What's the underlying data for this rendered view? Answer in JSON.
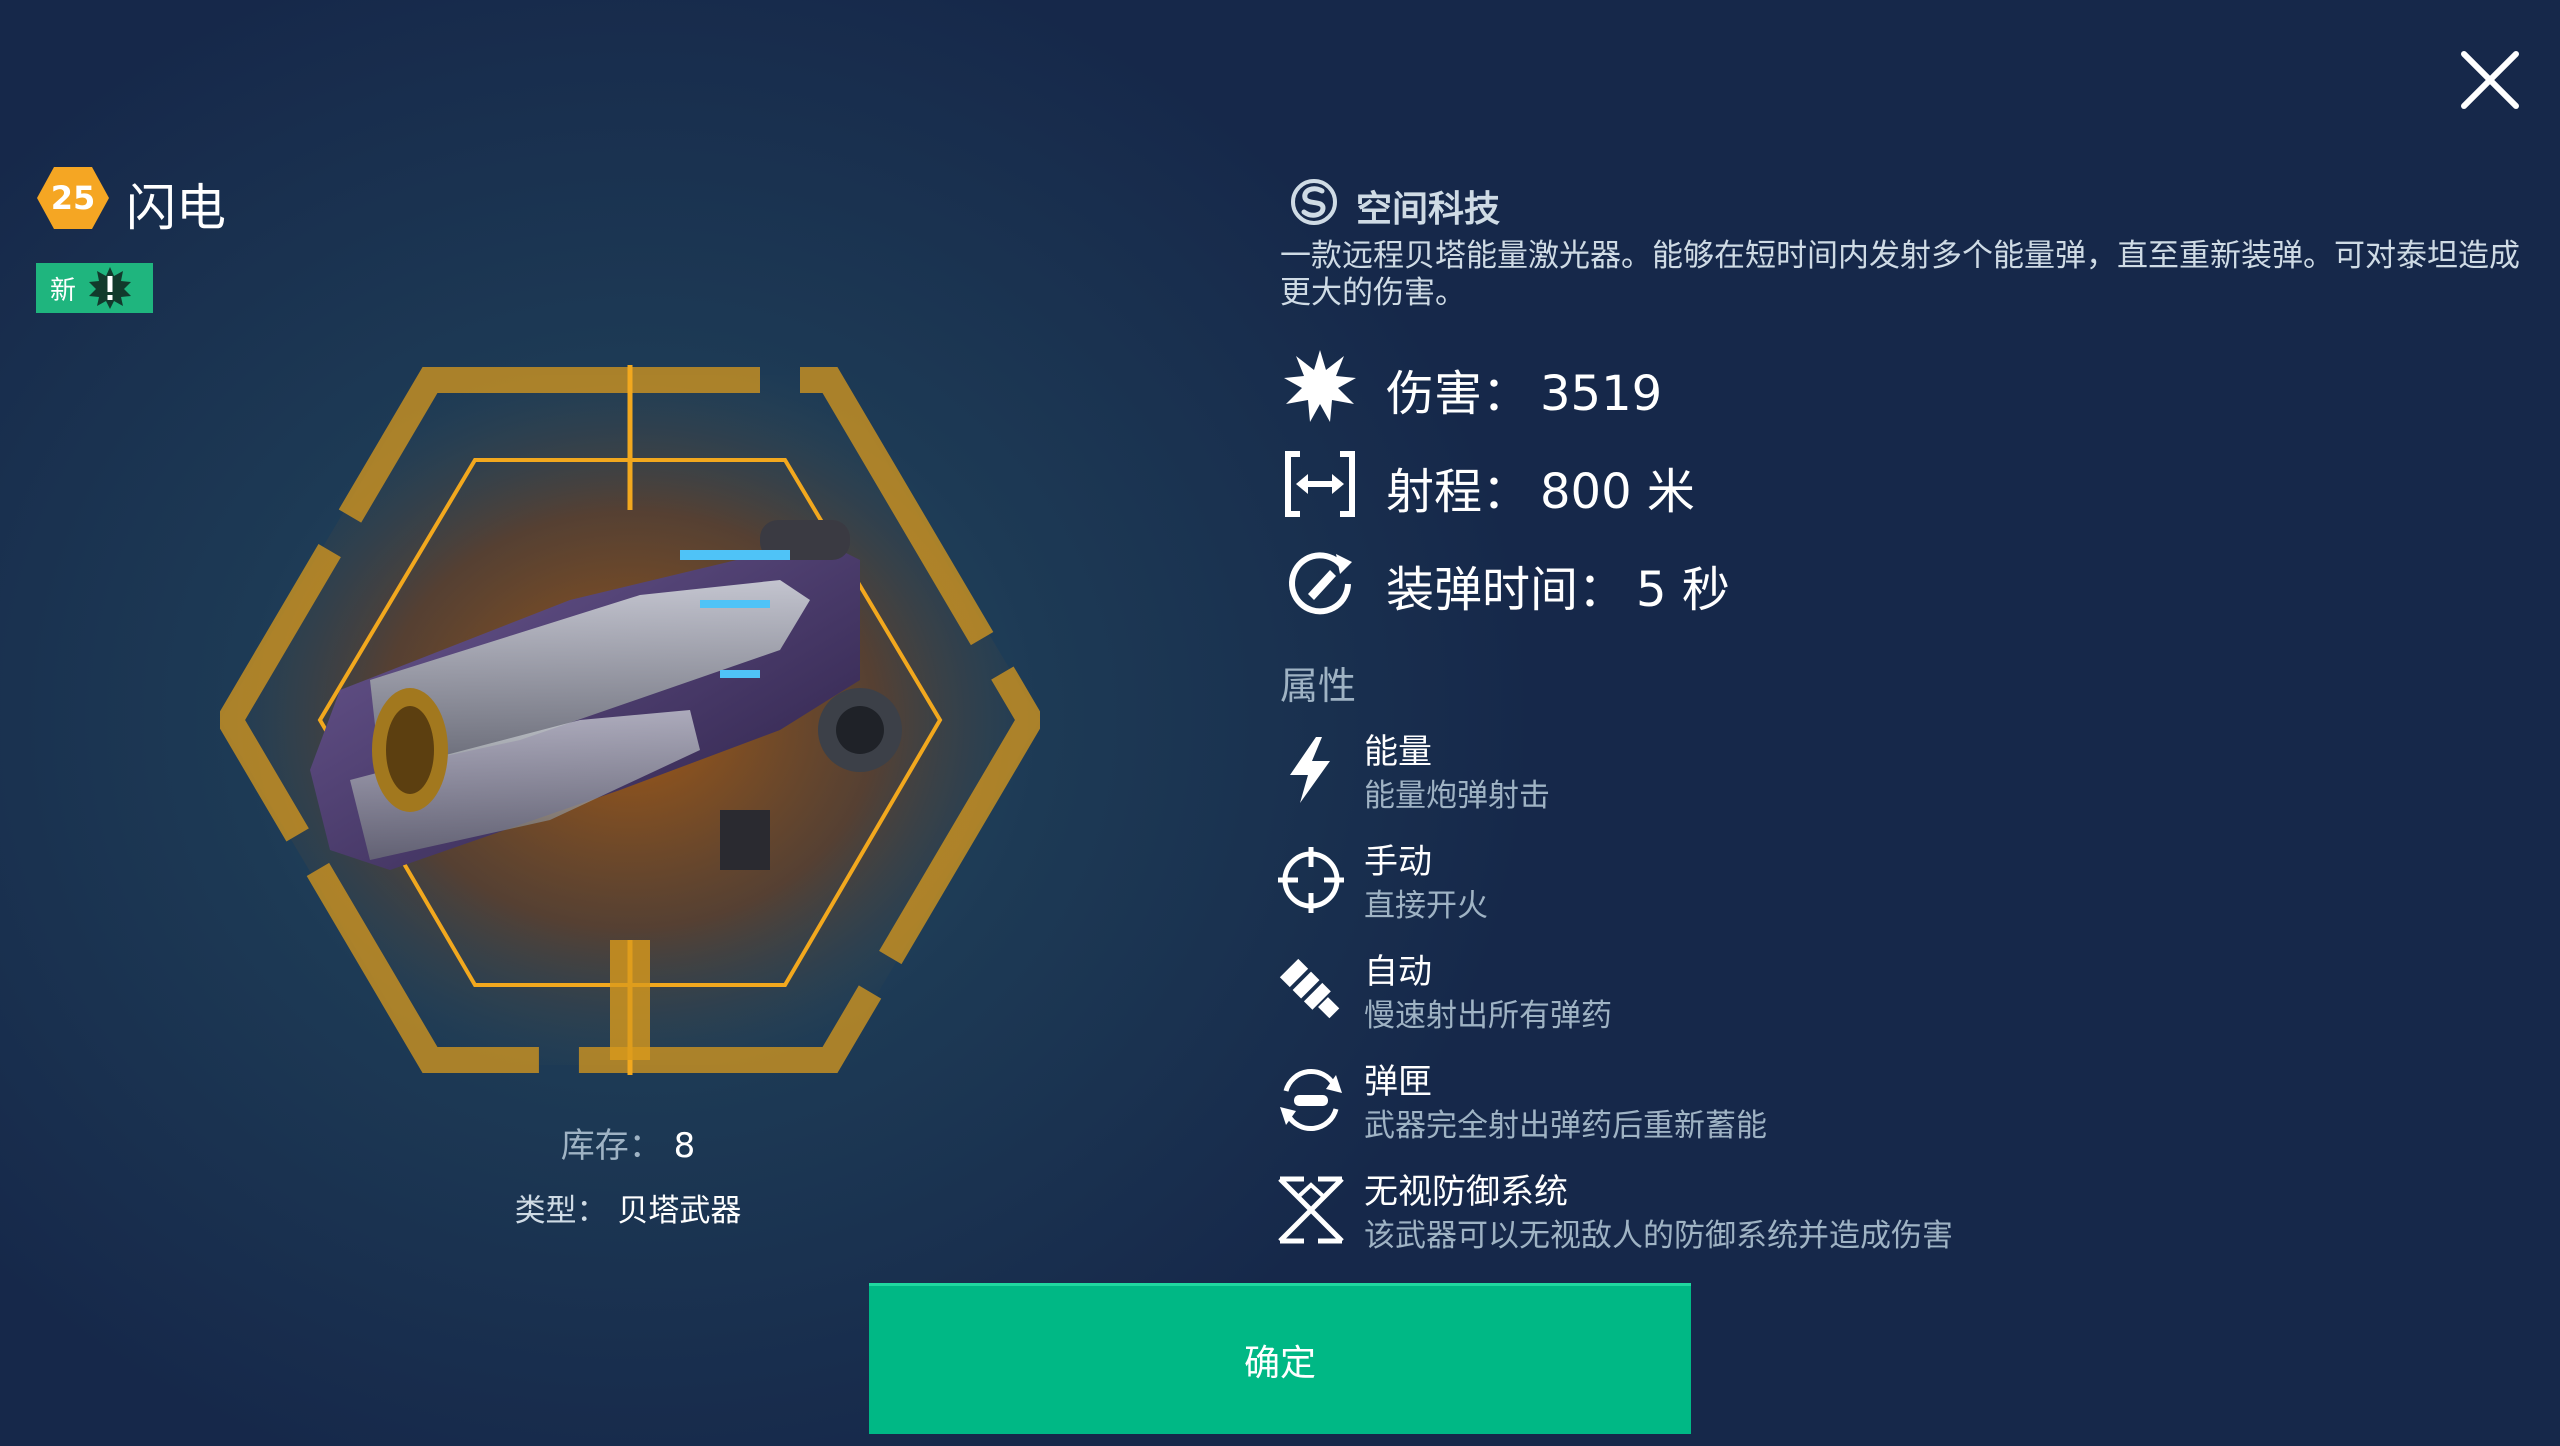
{
  "header": {
    "level": "25",
    "weapon_name": "闪电",
    "new_badge": "新"
  },
  "inventory": {
    "stock_label": "库存：",
    "stock_value": "8",
    "type_label": "类型：",
    "type_value": "贝塔武器"
  },
  "manufacturer": {
    "name": "空间科技",
    "description": "一款远程贝塔能量激光器。能够在短时间内发射多个能量弹，直至重新装弹。可对泰坦造成更大的伤害。"
  },
  "stats": [
    {
      "icon": "explosion-icon",
      "label": "伤害：",
      "value": "3519"
    },
    {
      "icon": "range-icon",
      "label": "射程：",
      "value": "800 米"
    },
    {
      "icon": "reload-icon",
      "label": "装弹时间：",
      "value": "5 秒"
    }
  ],
  "attributes_heading": "属性",
  "attributes": [
    {
      "icon": "lightning-icon",
      "title": "能量",
      "subtitle": "能量炮弹射击"
    },
    {
      "icon": "crosshair-icon",
      "title": "手动",
      "subtitle": "直接开火"
    },
    {
      "icon": "auto-fire-icon",
      "title": "自动",
      "subtitle": "慢速射出所有弹药"
    },
    {
      "icon": "magazine-icon",
      "title": "弹匣",
      "subtitle": "武器完全射出弹药后重新蓄能"
    },
    {
      "icon": "ignore-defense-icon",
      "title": "无视防御系统",
      "subtitle": "该武器可以无视敌人的防御系统并造成伤害"
    }
  ],
  "confirm_label": "确定",
  "colors": {
    "accent_green": "#00b885",
    "badge_orange": "#f5a623",
    "frame_orange": "#e8a21c",
    "bg_dark": "#16284a"
  }
}
